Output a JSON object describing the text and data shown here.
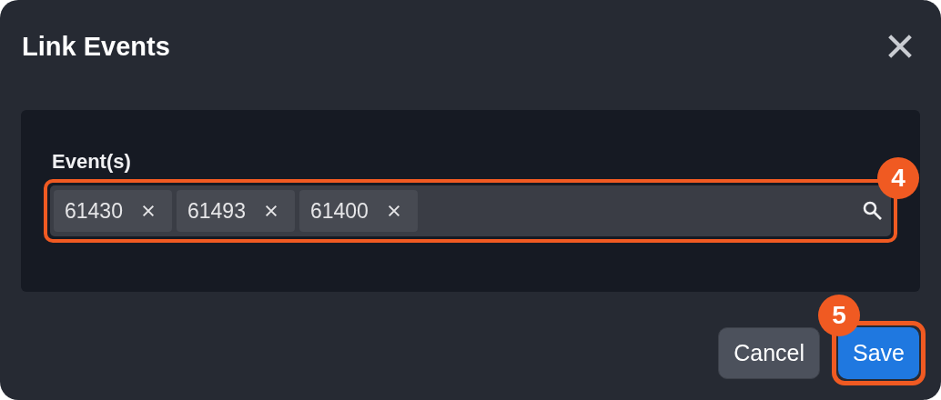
{
  "dialog": {
    "title": "Link Events"
  },
  "events_field": {
    "label": "Event(s)",
    "badge": "4",
    "tags": [
      {
        "text": "61430"
      },
      {
        "text": "61493"
      },
      {
        "text": "61400"
      }
    ]
  },
  "buttons": [
    {
      "kind": "secondary",
      "label": "Cancel"
    },
    {
      "kind": "primary",
      "label": "Save",
      "badge": "5"
    }
  ]
}
